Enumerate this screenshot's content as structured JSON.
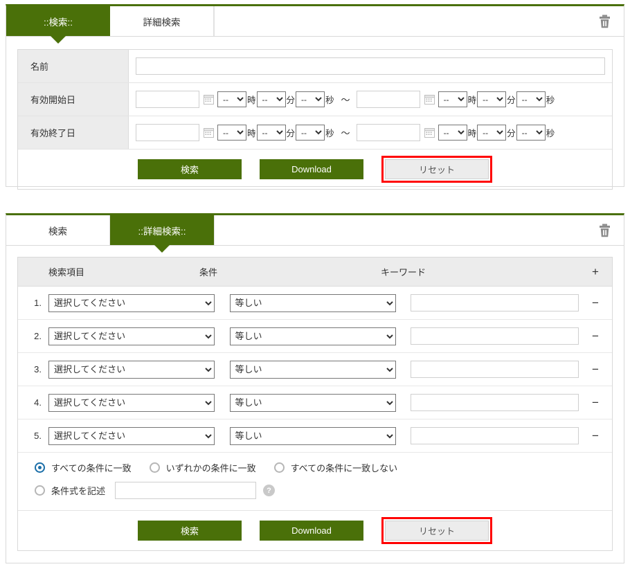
{
  "panels": {
    "basic": {
      "tabs": [
        {
          "label": "::検索::",
          "active": true
        },
        {
          "label": "詳細検索",
          "active": false
        }
      ],
      "trash_icon": "trash-icon",
      "fields": {
        "name_label": "名前",
        "name_value": "",
        "start_label": "有効開始日",
        "end_label": "有効終了日"
      },
      "datetime": {
        "date_value": "",
        "select_value": "--",
        "hour_unit": "時",
        "minute_unit": "分",
        "second_unit": "秒",
        "range_separator": "～",
        "calendar_icon": "calendar-icon"
      },
      "buttons": {
        "search": "検索",
        "download": "Download",
        "reset": "リセット"
      }
    },
    "advanced": {
      "tabs": [
        {
          "label": "検索",
          "active": false
        },
        {
          "label": "::詳細検索::",
          "active": true
        }
      ],
      "trash_icon": "trash-icon",
      "headers": {
        "item": "検索項目",
        "condition": "条件",
        "keyword": "キーワード",
        "add": "+"
      },
      "remove_symbol": "−",
      "rows": [
        {
          "num": "1.",
          "item": "選択してください",
          "condition": "等しい",
          "keyword": ""
        },
        {
          "num": "2.",
          "item": "選択してください",
          "condition": "等しい",
          "keyword": ""
        },
        {
          "num": "3.",
          "item": "選択してください",
          "condition": "等しい",
          "keyword": ""
        },
        {
          "num": "4.",
          "item": "選択してください",
          "condition": "等しい",
          "keyword": ""
        },
        {
          "num": "5.",
          "item": "選択してください",
          "condition": "等しい",
          "keyword": ""
        }
      ],
      "match_options": [
        {
          "label": "すべての条件に一致",
          "selected": true
        },
        {
          "label": "いずれかの条件に一致",
          "selected": false
        },
        {
          "label": "すべての条件に一致しない",
          "selected": false
        }
      ],
      "expression": {
        "label": "条件式を記述",
        "selected": false,
        "value": "",
        "help_icon": "help-icon",
        "help_glyph": "?"
      },
      "buttons": {
        "search": "検索",
        "download": "Download",
        "reset": "リセット"
      }
    }
  },
  "colors": {
    "accent_green": "#4a7009",
    "highlight_red": "#ff0000",
    "radio_blue": "#1a6ea8",
    "header_gray": "#ececec"
  }
}
